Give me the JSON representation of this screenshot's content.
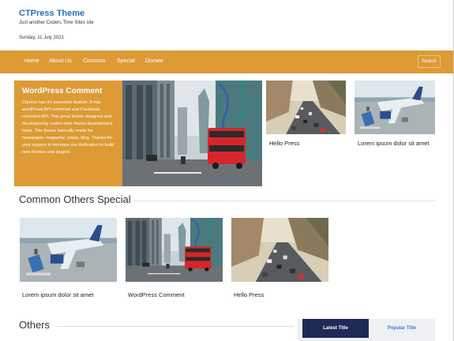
{
  "site": {
    "title": "CTPress Theme",
    "description": "Just another Coders Time Sites site",
    "date": "Sunday, 11 July 2021"
  },
  "nav": {
    "items": [
      "Home",
      "About Us",
      "Common",
      "Special",
      "Donate"
    ],
    "search_label": "Search"
  },
  "hero": {
    "title": "WordPress Comment",
    "text": "Ctpress has it's awesome feature. It has wordPress API comment and Facebook comment API. This great theme designed and developed by coders time theme development team. This theme basically made for newspaper, magazine, press, blog. Thanks for your support to increase our dedication to build new themes and plugins."
  },
  "featured": [
    {
      "caption": "Hello Press",
      "image": "city-traffic-image"
    },
    {
      "caption": "Lorem ipsum dolor sit amet",
      "image": "airport-plane-image"
    }
  ],
  "sections": {
    "common": {
      "heading": "Common Others Special",
      "posts": [
        {
          "caption": "Lorem ipsum dolor sit amet",
          "image": "airport-plane-image"
        },
        {
          "caption": "WordPress Comment",
          "image": "london-bus-image"
        },
        {
          "caption": "Hello Press",
          "image": "city-traffic-image"
        }
      ]
    },
    "others": {
      "heading": "Others"
    }
  },
  "tabs": {
    "latest": "Latest Title",
    "popular": "Popular Title"
  },
  "colors": {
    "accent": "#dd9a35",
    "title_blue": "#2a6fc4",
    "tab_dark": "#1d2b56"
  }
}
